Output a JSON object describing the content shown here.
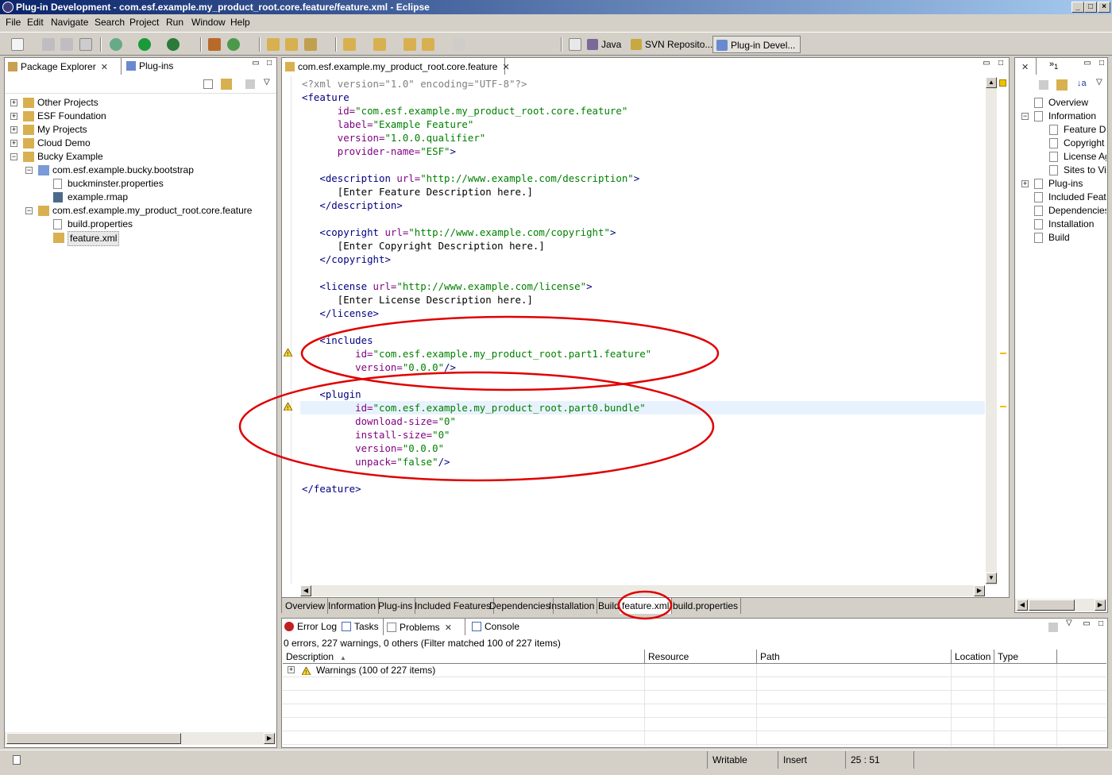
{
  "window": {
    "title": "Plug-in Development - com.esf.example.my_product_root.core.feature/feature.xml - Eclipse"
  },
  "menu": [
    "File",
    "Edit",
    "Navigate",
    "Search",
    "Project",
    "Run",
    "Window",
    "Help"
  ],
  "perspectives": [
    {
      "label": "Java",
      "icon": "java-perspective-icon"
    },
    {
      "label": "SVN Reposito...",
      "icon": "svn-perspective-icon"
    },
    {
      "label": "Plug-in Devel...",
      "icon": "plugin-perspective-icon"
    }
  ],
  "explorer": {
    "tabs": [
      "Package Explorer",
      "Plug-ins"
    ],
    "tree": [
      {
        "label": "Other Projects"
      },
      {
        "label": "ESF Foundation"
      },
      {
        "label": "My Projects"
      },
      {
        "label": "Cloud Demo"
      },
      {
        "label": "Bucky Example"
      },
      {
        "label": "com.esf.example.bucky.bootstrap"
      },
      {
        "label": "buckminster.properties"
      },
      {
        "label": "example.rmap"
      },
      {
        "label": "com.esf.example.my_product_root.core.feature"
      },
      {
        "label": "build.properties"
      },
      {
        "label": "feature.xml"
      }
    ]
  },
  "editor": {
    "tab": "com.esf.example.my_product_root.core.feature",
    "lines": [
      [
        [
          "pi",
          "<?xml version=\"1.0\" encoding=\"UTF-8\"?>"
        ]
      ],
      [
        [
          "tg",
          "<feature"
        ]
      ],
      [
        [
          "tx",
          "      "
        ],
        [
          "at",
          "id="
        ],
        [
          "vs",
          "\"com.esf.example.my_product_root.core.feature\""
        ]
      ],
      [
        [
          "tx",
          "      "
        ],
        [
          "at",
          "label="
        ],
        [
          "vs",
          "\"Example Feature\""
        ]
      ],
      [
        [
          "tx",
          "      "
        ],
        [
          "at",
          "version="
        ],
        [
          "vs",
          "\"1.0.0.qualifier\""
        ]
      ],
      [
        [
          "tx",
          "      "
        ],
        [
          "at",
          "provider-name="
        ],
        [
          "vs",
          "\"ESF\""
        ],
        [
          "tg",
          ">"
        ]
      ],
      [],
      [
        [
          "tx",
          "   "
        ],
        [
          "tg",
          "<description "
        ],
        [
          "at",
          "url="
        ],
        [
          "vs",
          "\"http://www.example.com/description\""
        ],
        [
          "tg",
          ">"
        ]
      ],
      [
        [
          "tx",
          "      [Enter Feature Description here.]"
        ]
      ],
      [
        [
          "tx",
          "   "
        ],
        [
          "tg",
          "</description>"
        ]
      ],
      [],
      [
        [
          "tx",
          "   "
        ],
        [
          "tg",
          "<copyright "
        ],
        [
          "at",
          "url="
        ],
        [
          "vs",
          "\"http://www.example.com/copyright\""
        ],
        [
          "tg",
          ">"
        ]
      ],
      [
        [
          "tx",
          "      [Enter Copyright Description here.]"
        ]
      ],
      [
        [
          "tx",
          "   "
        ],
        [
          "tg",
          "</copyright>"
        ]
      ],
      [],
      [
        [
          "tx",
          "   "
        ],
        [
          "tg",
          "<license "
        ],
        [
          "at",
          "url="
        ],
        [
          "vs",
          "\"http://www.example.com/license\""
        ],
        [
          "tg",
          ">"
        ]
      ],
      [
        [
          "tx",
          "      [Enter License Description here.]"
        ]
      ],
      [
        [
          "tx",
          "   "
        ],
        [
          "tg",
          "</license>"
        ]
      ],
      [],
      [
        [
          "tx",
          "   "
        ],
        [
          "tg",
          "<includes"
        ]
      ],
      [
        [
          "tx",
          "         "
        ],
        [
          "at",
          "id="
        ],
        [
          "vs",
          "\"com.esf.example.my_product_root.part1.feature\""
        ]
      ],
      [
        [
          "tx",
          "         "
        ],
        [
          "at",
          "version="
        ],
        [
          "vs",
          "\"0.0.0\""
        ],
        [
          "tg",
          "/>"
        ]
      ],
      [],
      [
        [
          "tx",
          "   "
        ],
        [
          "tg",
          "<plugin"
        ]
      ],
      [
        [
          "tx",
          "         "
        ],
        [
          "at",
          "id="
        ],
        [
          "vs",
          "\"com.esf.example.my_product_root.part0.bundle\""
        ]
      ],
      [
        [
          "tx",
          "         "
        ],
        [
          "at",
          "download-size="
        ],
        [
          "vs",
          "\"0\""
        ]
      ],
      [
        [
          "tx",
          "         "
        ],
        [
          "at",
          "install-size="
        ],
        [
          "vs",
          "\"0\""
        ]
      ],
      [
        [
          "tx",
          "         "
        ],
        [
          "at",
          "version="
        ],
        [
          "vs",
          "\"0.0.0\""
        ]
      ],
      [
        [
          "tx",
          "         "
        ],
        [
          "at",
          "unpack="
        ],
        [
          "vs",
          "\"false\""
        ],
        [
          "tg",
          "/>"
        ]
      ],
      [],
      [
        [
          "tg",
          "</feature>"
        ]
      ]
    ],
    "bottom_tabs": [
      "Overview",
      "Information",
      "Plug-ins",
      "Included Features",
      "Dependencies",
      "Installation",
      "Build",
      "feature.xml",
      "build.properties"
    ]
  },
  "outline": {
    "tree": [
      {
        "label": "Overview"
      },
      {
        "label": "Information"
      },
      {
        "label": "Feature De"
      },
      {
        "label": "Copyright N"
      },
      {
        "label": "License Agr"
      },
      {
        "label": "Sites to Visi"
      },
      {
        "label": "Plug-ins"
      },
      {
        "label": "Included Featu"
      },
      {
        "label": "Dependencies"
      },
      {
        "label": "Installation"
      },
      {
        "label": "Build"
      }
    ]
  },
  "problems": {
    "tabs": [
      "Error Log",
      "Tasks",
      "Problems",
      "Console"
    ],
    "summary": "0 errors, 227 warnings, 0 others (Filter matched 100 of 227 items)",
    "columns": [
      "Description",
      "Resource",
      "Path",
      "Location",
      "Type"
    ],
    "rows": [
      {
        "description": "Warnings (100 of 227 items)"
      }
    ]
  },
  "status": {
    "mode": "Writable",
    "insert": "Insert",
    "position": "25 : 51"
  },
  "colors": {
    "title_start": "#0a246a",
    "title_end": "#a6caf0",
    "annotation": "#e00000",
    "tag": "#00007f",
    "attribute": "#7f007f",
    "value": "#008000"
  }
}
